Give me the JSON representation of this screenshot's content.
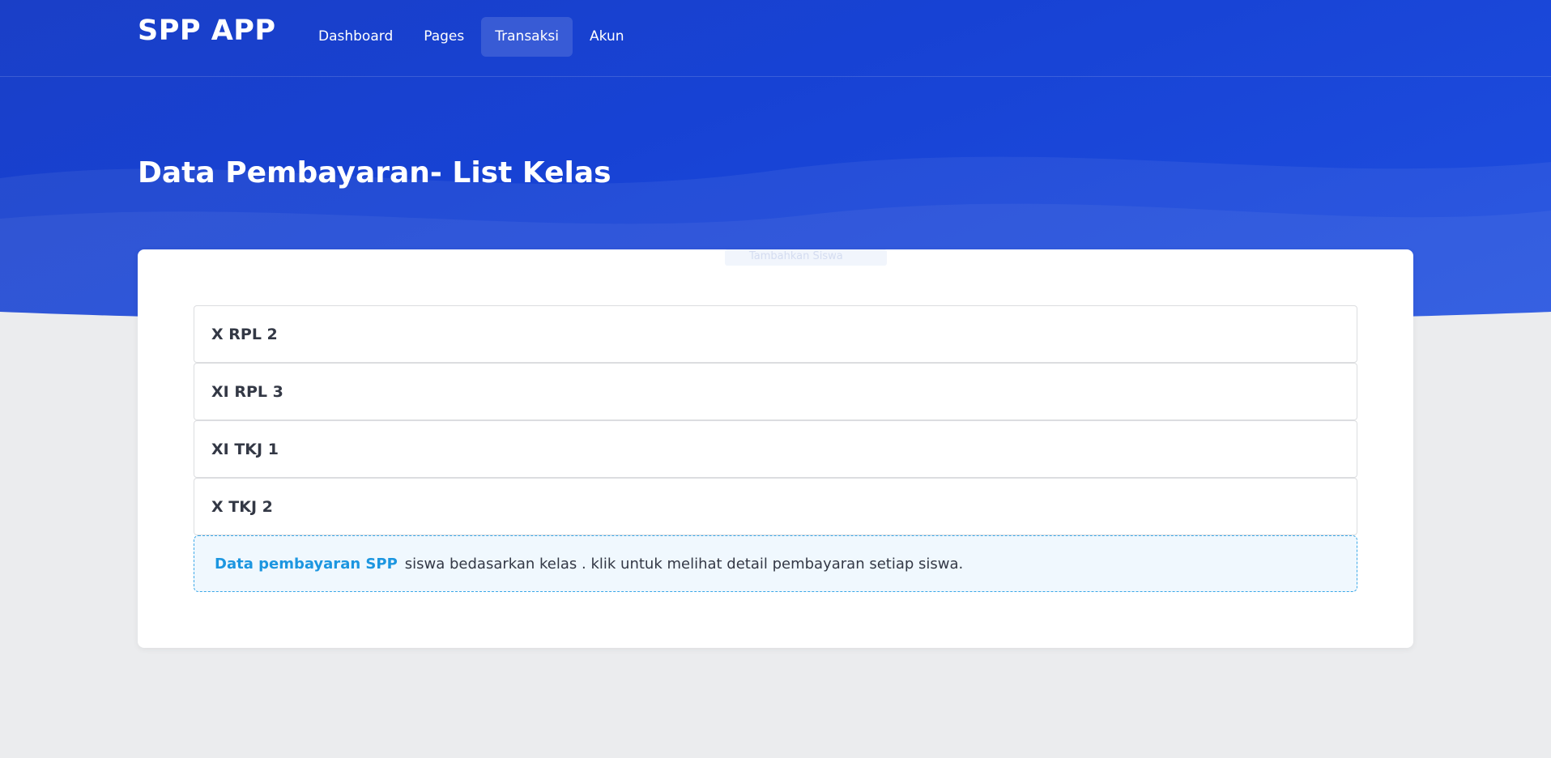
{
  "app": {
    "brand": "SPP APP"
  },
  "nav": {
    "items": [
      {
        "label": "Dashboard"
      },
      {
        "label": "Pages"
      },
      {
        "label": "Transaksi"
      },
      {
        "label": "Akun"
      }
    ],
    "active": "Transaksi"
  },
  "page": {
    "title": "Data Pembayaran- List Kelas"
  },
  "classes": [
    {
      "name": "X RPL 2"
    },
    {
      "name": "XI RPL 3"
    },
    {
      "name": "XI TKJ 1"
    },
    {
      "name": "X TKJ 2"
    }
  ],
  "info": {
    "highlight": "Data pembayaran SPP",
    "text": "siswa bedasarkan kelas . klik untuk melihat detail pembayaran setiap siswa."
  },
  "ghost_badge": {
    "text": "Tambahkan Siswa"
  },
  "colors": {
    "hero": "#1742d4",
    "accent": "#1c96e0",
    "background": "#ebecee"
  }
}
